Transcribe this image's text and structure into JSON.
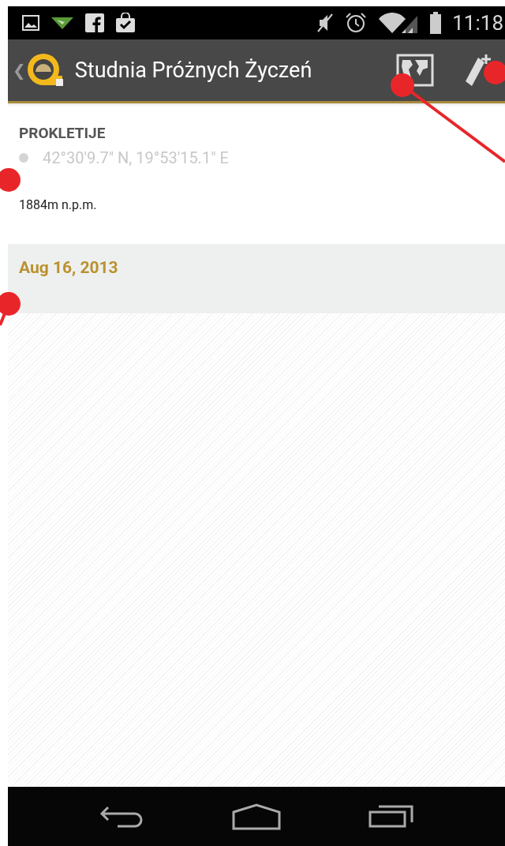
{
  "status_bar": {
    "time": "11:18"
  },
  "action_bar": {
    "back": "❮",
    "title": "Studnia Próżnych Życzeń"
  },
  "place": {
    "name": "PROKLETIJE",
    "coordinates": "42°30'9.7\" N, 19°53'15.1\" E",
    "elevation": "1884m n.p.m."
  },
  "date_header": {
    "date": "Aug 16, 2013"
  }
}
